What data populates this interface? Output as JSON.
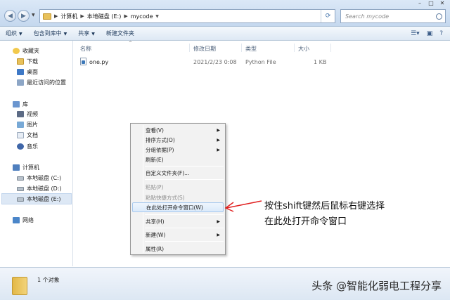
{
  "address": {
    "crumbs": [
      "计算机",
      "本地磁盘 (E:)",
      "mycode"
    ],
    "search_placeholder": "Search mycode"
  },
  "toolbar": {
    "organize": "组织",
    "include_in_library": "包含到库中",
    "share": "共享",
    "new_folder": "新建文件夹"
  },
  "nav": {
    "favorites": "收藏夹",
    "downloads": "下载",
    "desktop": "桌面",
    "recent": "最近访问的位置",
    "libraries": "库",
    "videos": "视频",
    "pictures": "图片",
    "documents": "文档",
    "music": "音乐",
    "computer": "计算机",
    "drive_c": "本地磁盘 (C:)",
    "drive_d": "本地磁盘 (D:)",
    "drive_e": "本地磁盘 (E:)",
    "network": "网络"
  },
  "columns": {
    "name": "名称",
    "modified": "修改日期",
    "type": "类型",
    "size": "大小"
  },
  "file": {
    "name": "one.py",
    "modified": "2021/2/23 0:08",
    "type": "Python File",
    "size": "1 KB"
  },
  "context_menu": {
    "view": "查看(V)",
    "sort_by": "排序方式(O)",
    "group_by": "分组依据(P)",
    "refresh": "刷新(E)",
    "customize": "自定义文件夹(F)...",
    "paste": "粘贴(P)",
    "paste_shortcut": "粘贴快捷方式(S)",
    "open_cmd": "在此处打开命令窗口(W)",
    "share": "共享(H)",
    "new": "新建(W)",
    "properties": "属性(R)"
  },
  "annotation": {
    "line1": "按住shift键然后鼠标右键选择",
    "line2": "在此处打开命令窗口"
  },
  "status": {
    "count": "1 个对象"
  },
  "watermark": "头条 @智能化弱电工程分享"
}
